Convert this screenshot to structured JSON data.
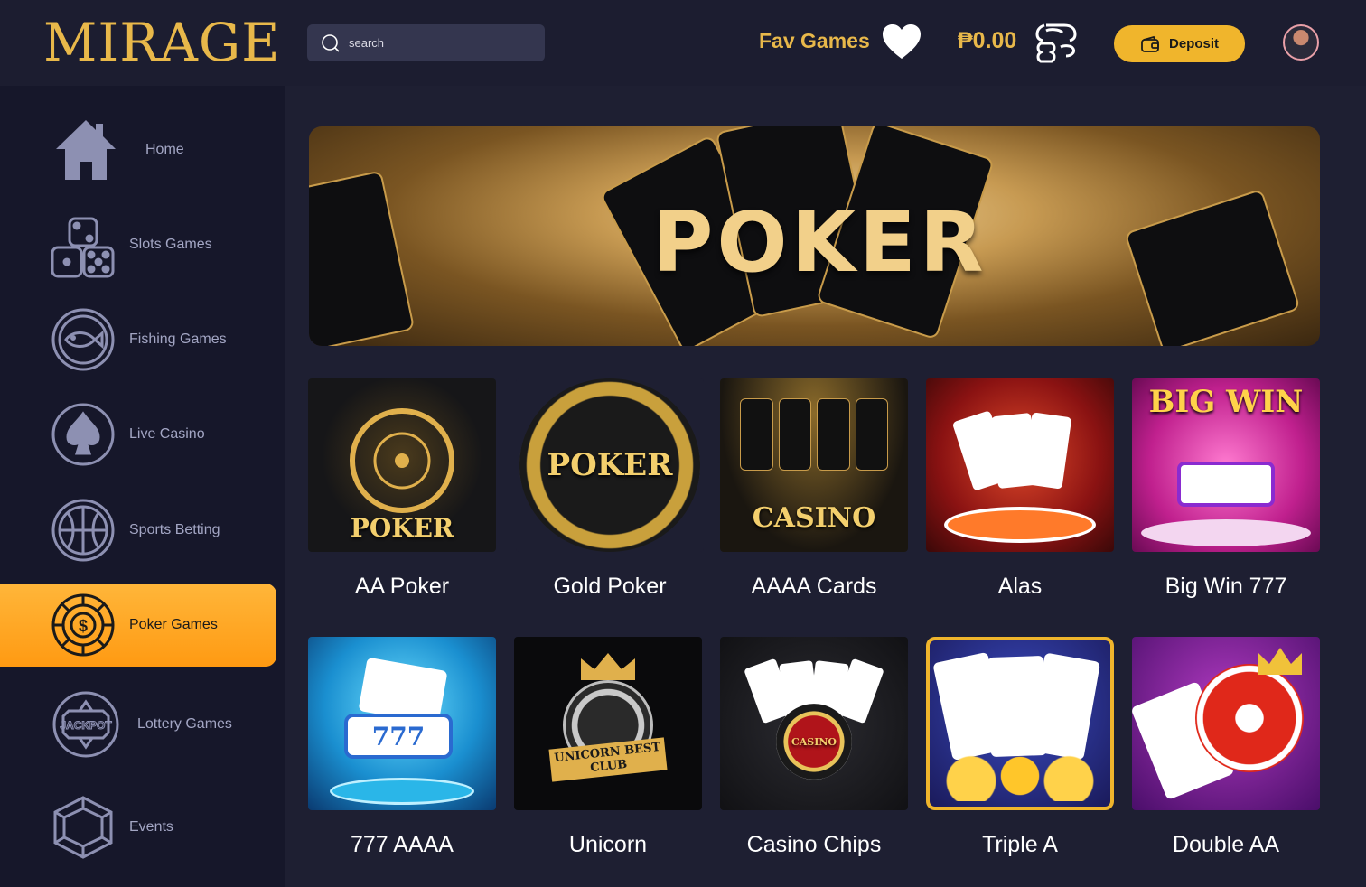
{
  "header": {
    "logo_text": "MIRAGE",
    "search_placeholder": "search",
    "fav_label": "Fav Games",
    "balance": "₱0.00",
    "deposit_label": "Deposit"
  },
  "sidebar": {
    "items": [
      {
        "label": "Home",
        "icon": "home-icon"
      },
      {
        "label": "Slots Games",
        "icon": "dice-icon"
      },
      {
        "label": "Fishing Games",
        "icon": "fish-icon"
      },
      {
        "label": "Live Casino",
        "icon": "spade-icon"
      },
      {
        "label": "Sports Betting",
        "icon": "basketball-icon"
      },
      {
        "label": "Poker Games",
        "icon": "poker-chip-icon",
        "active": true
      },
      {
        "label": "Lottery Games",
        "icon": "jackpot-icon"
      },
      {
        "label": "Events",
        "icon": "gem-icon"
      }
    ]
  },
  "banner": {
    "title": "POKER"
  },
  "games": [
    {
      "name": "AA Poker",
      "thumb_text": "POKER"
    },
    {
      "name": "Gold Poker",
      "thumb_text": "POKER"
    },
    {
      "name": "AAAA Cards",
      "thumb_text": "CASINO"
    },
    {
      "name": "Alas",
      "thumb_text": ""
    },
    {
      "name": "Big Win 777",
      "thumb_text": "BIG WIN"
    },
    {
      "name": "777 AAAA",
      "thumb_text": "777"
    },
    {
      "name": "Unicorn",
      "thumb_text": "UNICORN BEST CLUB"
    },
    {
      "name": "Casino Chips",
      "thumb_text": "CASINO"
    },
    {
      "name": "Triple A",
      "thumb_text": ""
    },
    {
      "name": "Double AA",
      "thumb_text": ""
    }
  ],
  "colors": {
    "accent": "#f0b52c",
    "background": "#1e1f32",
    "sidebar": "#16172a",
    "nav_text": "#a3a6c4"
  }
}
